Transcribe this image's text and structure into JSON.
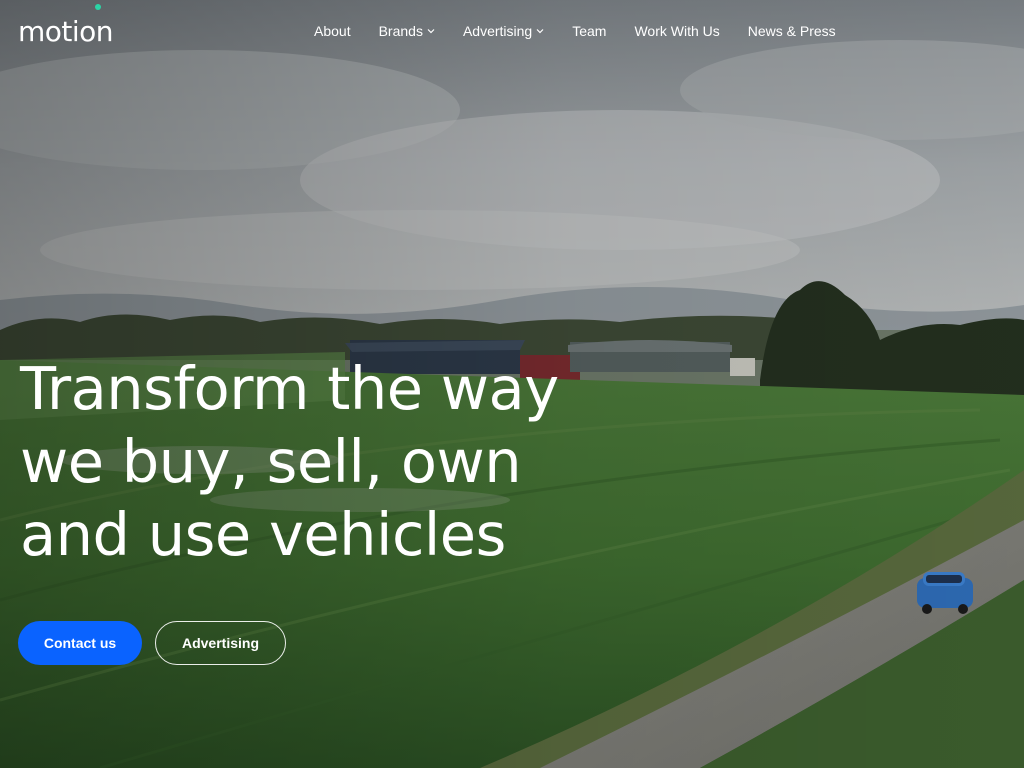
{
  "brand": {
    "name": "motion",
    "accent_color": "#2bd4a6"
  },
  "nav": {
    "items": [
      {
        "label": "About",
        "has_dropdown": false
      },
      {
        "label": "Brands",
        "has_dropdown": true
      },
      {
        "label": "Advertising",
        "has_dropdown": true
      },
      {
        "label": "Team",
        "has_dropdown": false
      },
      {
        "label": "Work With Us",
        "has_dropdown": false
      },
      {
        "label": "News & Press",
        "has_dropdown": false
      }
    ]
  },
  "hero": {
    "headline_lines": [
      "Transform the way",
      "we buy, sell, own",
      "and use vehicles"
    ],
    "primary_cta": "Contact us",
    "secondary_cta": "Advertising",
    "primary_color": "#0a63ff"
  },
  "icons": {
    "dropdown": "chevron-down-icon"
  }
}
